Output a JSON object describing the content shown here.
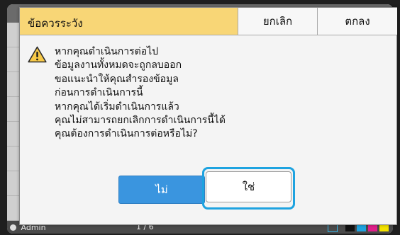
{
  "dialog": {
    "title": "ข้อควรระวัง",
    "cancel_label": "ยกเลิก",
    "ok_label": "ตกลง",
    "warning_icon": "warning-triangle-icon",
    "message_lines": [
      "หากคุณดำเนินการต่อไป",
      "ข้อมูลงานทั้งหมดจะถูกลบออก",
      "ขอแนะนำให้คุณสำรองข้อมูล",
      "ก่อนการดำเนินการนี้",
      "หากคุณได้เริ่มดำเนินการแล้ว",
      "คุณไม่สามารถยกเลิกการดำเนินการนี้ได้",
      "คุณต้องการดำเนินการต่อหรือไม่?"
    ],
    "no_label": "ไม่",
    "yes_label": "ใช่"
  },
  "background": {
    "status_user": "Admin",
    "status_middle": "1 / 6"
  },
  "colors": {
    "title_bar": "#f8d676",
    "no_button": "#3a95df",
    "focus_ring": "#1ea3e0",
    "ink_black": "#111111",
    "ink_cyan": "#1fa3e0",
    "ink_magenta": "#e0208a",
    "ink_yellow": "#f3e200"
  }
}
